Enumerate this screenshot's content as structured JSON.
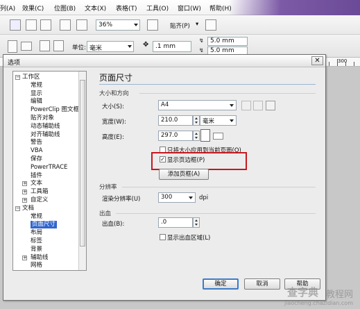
{
  "menubar": {
    "items": [
      "列(A)",
      "效果(C)",
      "位图(B)",
      "文本(X)",
      "表格(T)",
      "工具(O)",
      "窗口(W)",
      "帮助(H)"
    ]
  },
  "toolbar1": {
    "zoom": "36%",
    "snap": "贴齐(P)"
  },
  "toolbar2": {
    "unit_label": "单位:",
    "unit_value": "毫米",
    "nudge": ".1 mm",
    "dup_x": "5.0 mm",
    "dup_y": "5.0 mm"
  },
  "ruler": {
    "label": "300"
  },
  "dialog": {
    "title": "选项",
    "close": "✕",
    "tree": [
      {
        "label": "工作区",
        "level": 0,
        "toggle": "−"
      },
      {
        "label": "常规",
        "level": 1
      },
      {
        "label": "显示",
        "level": 1
      },
      {
        "label": "编辑",
        "level": 1
      },
      {
        "label": "PowerClip 图文框",
        "level": 1
      },
      {
        "label": "贴齐对象",
        "level": 1
      },
      {
        "label": "动态辅助线",
        "level": 1
      },
      {
        "label": "对齐辅助线",
        "level": 1
      },
      {
        "label": "警告",
        "level": 1
      },
      {
        "label": "VBA",
        "level": 1
      },
      {
        "label": "保存",
        "level": 1
      },
      {
        "label": "PowerTRACE",
        "level": 1
      },
      {
        "label": "插件",
        "level": 1
      },
      {
        "label": "文本",
        "level": 1,
        "toggle": "+"
      },
      {
        "label": "工具箱",
        "level": 1,
        "toggle": "+"
      },
      {
        "label": "自定义",
        "level": 1,
        "toggle": "+"
      },
      {
        "label": "文档",
        "level": 0,
        "toggle": "−"
      },
      {
        "label": "常规",
        "level": 1
      },
      {
        "label": "页面尺寸",
        "level": 1,
        "selected": true
      },
      {
        "label": "布局",
        "level": 1
      },
      {
        "label": "标签",
        "level": 1
      },
      {
        "label": "背景",
        "level": 1
      },
      {
        "label": "辅助线",
        "level": 1,
        "toggle": "+"
      },
      {
        "label": "网格",
        "level": 1
      }
    ],
    "panel": {
      "heading": "页面尺寸",
      "size_section": "大小和方向",
      "size_label": "大小(S):",
      "size_value": "A4",
      "width_label": "宽度(W):",
      "width_value": "210.0",
      "height_label": "高度(E):",
      "height_value": "297.0",
      "unit_value": "毫米",
      "only_current": "只将大小应用到当前页面(O)",
      "show_border": "显示页边框(P)",
      "show_border_checked": true,
      "add_frame": "添加页框(A)",
      "res_section": "分辨率",
      "res_label": "渲染分辨率(U)",
      "res_value": "300",
      "res_unit": "dpi",
      "bleed_section": "出血",
      "bleed_label": "出血(B):",
      "bleed_value": ".0",
      "show_bleed": "显示出血区域(L)"
    },
    "buttons": {
      "ok": "确定",
      "cancel": "取消",
      "help": "帮助"
    }
  },
  "watermark": {
    "brand": "查字典",
    "tag": "教程网",
    "url": "jiaocheng.chazidian.com"
  },
  "colors": {
    "highlight": "#c8171c",
    "selection": "#3266cc",
    "ok_border": "#3d7bc7"
  }
}
